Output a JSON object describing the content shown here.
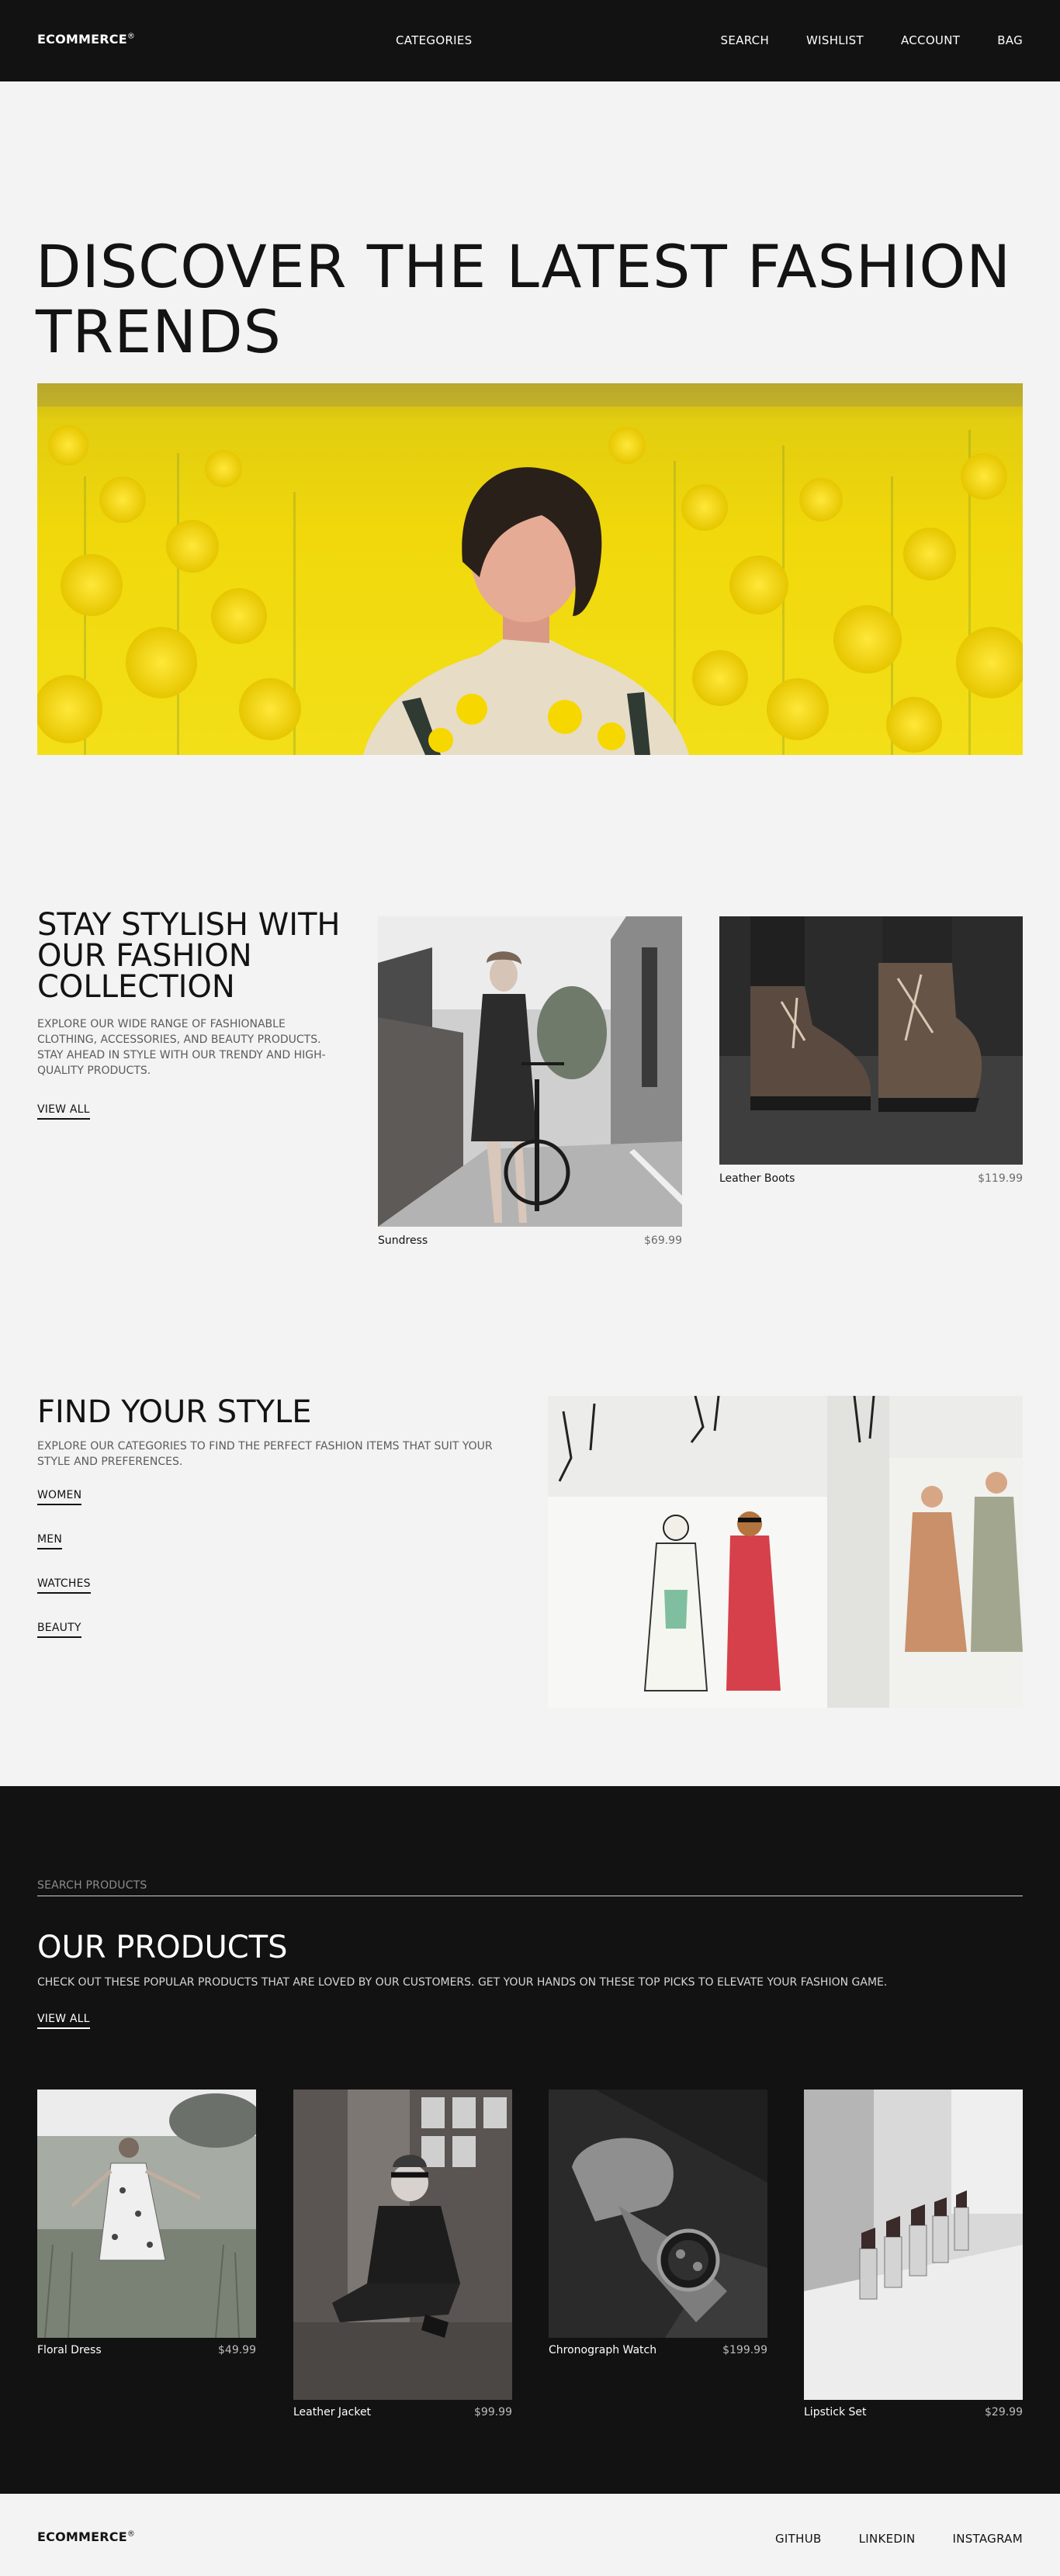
{
  "header": {
    "logo": "ECOMMERCE",
    "logo_mark": "®",
    "nav_center": "CATEGORIES",
    "nav_right": [
      "SEARCH",
      "WISHLIST",
      "ACCOUNT",
      "BAG"
    ]
  },
  "hero": {
    "title": "DISCOVER THE LATEST FASHION TRENDS"
  },
  "collection": {
    "title": "STAY STYLISH WITH OUR FASHION COLLECTION",
    "description": "EXPLORE OUR WIDE RANGE OF FASHIONABLE CLOTHING, ACCESSORIES, AND BEAUTY PRODUCTS. STAY AHEAD IN STYLE WITH OUR TRENDY AND HIGH-QUALITY PRODUCTS.",
    "view_all": "VIEW ALL",
    "items": [
      {
        "name": "Sundress",
        "price": "$69.99"
      },
      {
        "name": "Leather Boots",
        "price": "$119.99"
      }
    ]
  },
  "find_style": {
    "title": "FIND YOUR STYLE",
    "description": "EXPLORE OUR CATEGORIES TO FIND THE PERFECT FASHION ITEMS THAT SUIT YOUR STYLE AND PREFERENCES.",
    "categories": [
      "WOMEN",
      "MEN",
      "WATCHES",
      "BEAUTY"
    ]
  },
  "products": {
    "search_placeholder": "SEARCH PRODUCTS",
    "title": "OUR PRODUCTS",
    "description": "CHECK OUT THESE POPULAR PRODUCTS THAT ARE LOVED BY OUR CUSTOMERS. GET YOUR HANDS ON THESE TOP PICKS TO ELEVATE YOUR FASHION GAME.",
    "view_all": "VIEW ALL",
    "items": [
      {
        "name": "Floral Dress",
        "price": "$49.99"
      },
      {
        "name": "Leather Jacket",
        "price": "$99.99"
      },
      {
        "name": "Chronograph Watch",
        "price": "$199.99"
      },
      {
        "name": "Lipstick Set",
        "price": "$29.99"
      }
    ]
  },
  "footer": {
    "logo": "ECOMMERCE",
    "logo_mark": "®",
    "links": [
      "GITHUB",
      "LINKEDIN",
      "INSTAGRAM"
    ]
  }
}
